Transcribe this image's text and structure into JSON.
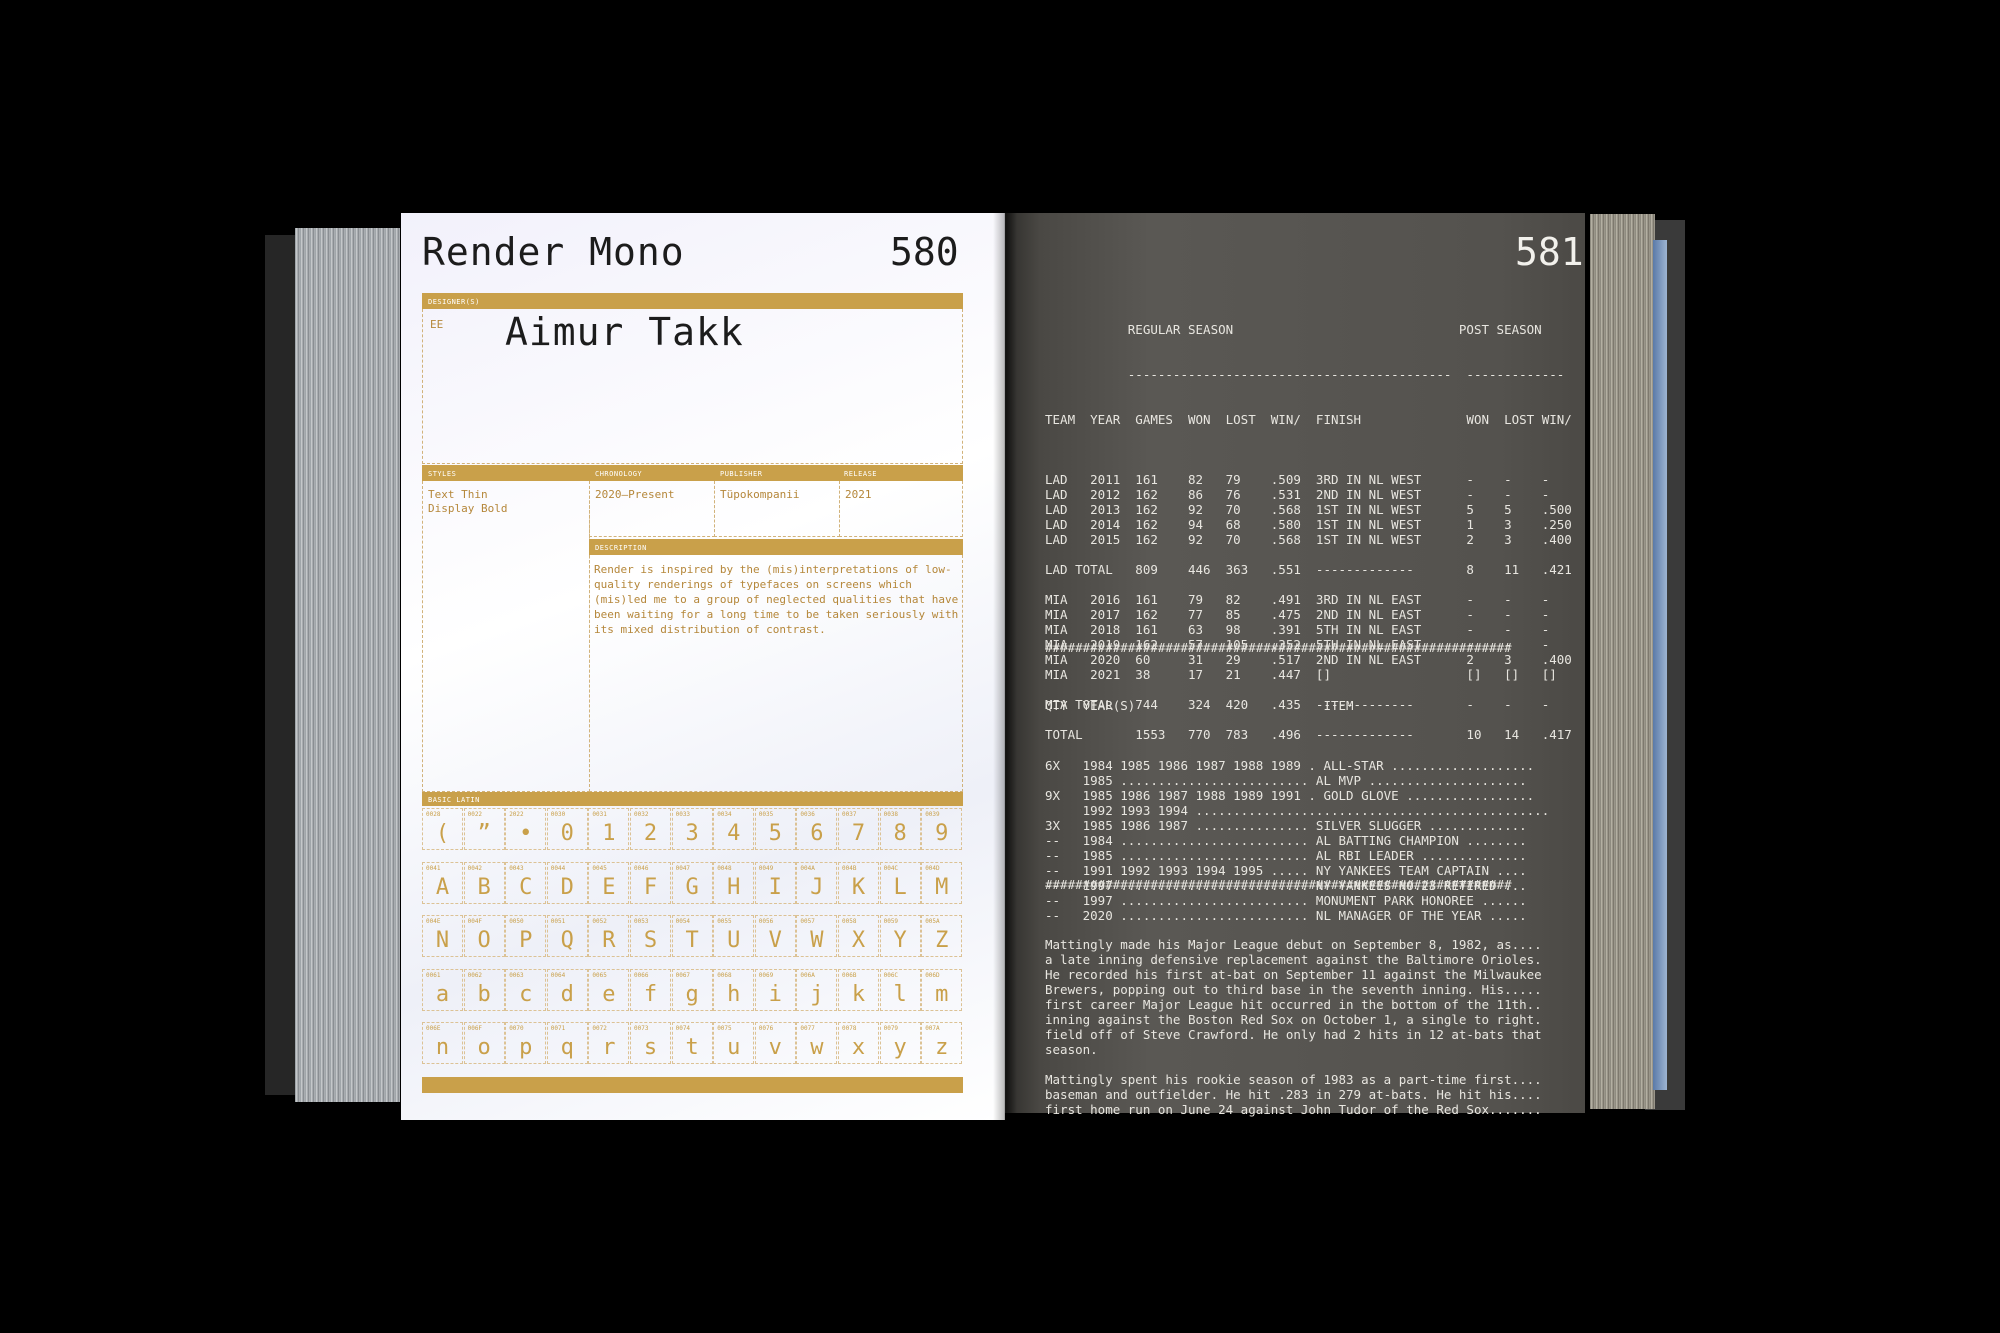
{
  "left_page": {
    "font_name": "Render Mono",
    "page_number": "580",
    "designer_label": "DESIGNER(S)",
    "designer_code": "EE",
    "designer_name": "Aimur Takk",
    "styles_label": "STYLES",
    "styles": [
      "Text Thin",
      "Display Bold"
    ],
    "chronology_label": "CHRONOLOGY",
    "chronology": "2020–Present",
    "publisher_label": "PUBLISHER",
    "publisher": "Tüpokompanii",
    "release_label": "RELEASE",
    "release": "2021",
    "description_label": "DESCRIPTION",
    "description": "Render is inspired by the (mis)interpretations of low-quality renderings of typefaces on screens which (mis)led me to a group of neglected qualities that have been waiting for a long time to be taken seriously with its mixed distribution of contrast.",
    "basic_latin_label": "BASIC LATIN",
    "glyph_rows": [
      [
        [
          "0028",
          "("
        ],
        [
          "0022",
          "”"
        ],
        [
          "2022",
          "•"
        ],
        [
          "0030",
          "0"
        ],
        [
          "0031",
          "1"
        ],
        [
          "0032",
          "2"
        ],
        [
          "0033",
          "3"
        ],
        [
          "0034",
          "4"
        ],
        [
          "0035",
          "5"
        ],
        [
          "0036",
          "6"
        ],
        [
          "0037",
          "7"
        ],
        [
          "0038",
          "8"
        ],
        [
          "0039",
          "9"
        ]
      ],
      [
        [
          "0041",
          "A"
        ],
        [
          "0042",
          "B"
        ],
        [
          "0043",
          "C"
        ],
        [
          "0044",
          "D"
        ],
        [
          "0045",
          "E"
        ],
        [
          "0046",
          "F"
        ],
        [
          "0047",
          "G"
        ],
        [
          "0048",
          "H"
        ],
        [
          "0049",
          "I"
        ],
        [
          "004A",
          "J"
        ],
        [
          "004B",
          "K"
        ],
        [
          "004C",
          "L"
        ],
        [
          "004D",
          "M"
        ]
      ],
      [
        [
          "004E",
          "N"
        ],
        [
          "004F",
          "O"
        ],
        [
          "0050",
          "P"
        ],
        [
          "0051",
          "Q"
        ],
        [
          "0052",
          "R"
        ],
        [
          "0053",
          "S"
        ],
        [
          "0054",
          "T"
        ],
        [
          "0055",
          "U"
        ],
        [
          "0056",
          "V"
        ],
        [
          "0057",
          "W"
        ],
        [
          "0058",
          "X"
        ],
        [
          "0059",
          "Y"
        ],
        [
          "005A",
          "Z"
        ]
      ],
      [
        [
          "0061",
          "a"
        ],
        [
          "0062",
          "b"
        ],
        [
          "0063",
          "c"
        ],
        [
          "0064",
          "d"
        ],
        [
          "0065",
          "e"
        ],
        [
          "0066",
          "f"
        ],
        [
          "0067",
          "g"
        ],
        [
          "0068",
          "h"
        ],
        [
          "0069",
          "i"
        ],
        [
          "006A",
          "j"
        ],
        [
          "006B",
          "k"
        ],
        [
          "006C",
          "l"
        ],
        [
          "006D",
          "m"
        ]
      ],
      [
        [
          "006E",
          "n"
        ],
        [
          "006F",
          "o"
        ],
        [
          "0070",
          "p"
        ],
        [
          "0071",
          "q"
        ],
        [
          "0072",
          "r"
        ],
        [
          "0073",
          "s"
        ],
        [
          "0074",
          "t"
        ],
        [
          "0075",
          "u"
        ],
        [
          "0076",
          "v"
        ],
        [
          "0077",
          "w"
        ],
        [
          "0078",
          "x"
        ],
        [
          "0079",
          "y"
        ],
        [
          "007A",
          "z"
        ]
      ]
    ]
  },
  "right_page": {
    "page_number": "581",
    "stats_header": [
      "           REGULAR SEASON                              POST SEASON",
      "           -------------------------------------------  -------------",
      "TEAM  YEAR  GAMES  WON  LOST  WIN/  FINISH              WON  LOST WIN/"
    ],
    "stats_lines": [
      "",
      "LAD   2011  161    82   79    .509  3RD IN NL WEST      -    -    -",
      "LAD   2012  162    86   76    .531  2ND IN NL WEST      -    -    -",
      "LAD   2013  162    92   70    .568  1ST IN NL WEST      5    5    .500",
      "LAD   2014  162    94   68    .580  1ST IN NL WEST      1    3    .250",
      "LAD   2015  162    92   70    .568  1ST IN NL WEST      2    3    .400",
      "",
      "LAD TOTAL   809    446  363   .551  -------------       8    11   .421",
      "",
      "MIA   2016  161    79   82    .491  3RD IN NL EAST      -    -    -",
      "MIA   2017  162    77   85    .475  2ND IN NL EAST      -    -    -",
      "MIA   2018  161    63   98    .391  5TH IN NL EAST      -    -    -",
      "MIA   2019  162    57   105   .352  5TH IN NL EAST      -    -    -",
      "MIA   2020  60     31   29    .517  2ND IN NL EAST      2    3    .400",
      "MIA   2021  38     17   21    .447  []                  []   []   []",
      "",
      "MIA TOTAL   744    324  420   .435  -------------       -    -    -",
      "",
      "TOTAL       1553   770  783   .496  -------------       10   14   .417"
    ],
    "divider": "##############################################################",
    "awards_header": "QTY  YEAR(S)                         ITEM",
    "award_lines": [
      "",
      "6X   1984 1985 1986 1987 1988 1989 . ALL-STAR ...................",
      "     1985 ......................... AL MVP .....................",
      "9X   1985 1986 1987 1988 1989 1991 . GOLD GLOVE .................",
      "     1992 1993 1994 ...............................................",
      "3X   1985 1986 1987 ............... SILVER SLUGGER .............",
      "--   1984 ......................... AL BATTING CHAMPION ........",
      "--   1985 ......................... AL RBI LEADER ..............",
      "--   1991 1992 1993 1994 1995 ..... NY YANKEES TEAM CAPTAIN ....",
      "--   1997 ......................... NY YANKEES NO.23 RETIRED ...",
      "--   1997 ......................... MONUMENT PARK HONOREE ......",
      "--   2020 ......................... NL MANAGER OF THE YEAR .....",
      ""
    ],
    "bio_lines": [
      "Mattingly made his Major League debut on September 8, 1982, as....",
      "a late inning defensive replacement against the Baltimore Orioles.",
      "He recorded his first at-bat on September 11 against the Milwaukee",
      "Brewers, popping out to third base in the seventh inning. His.....",
      "first career Major League hit occurred in the bottom of the 11th..",
      "inning against the Boston Red Sox on October 1, a single to right.",
      "field off of Steve Crawford. He only had 2 hits in 12 at-bats that",
      "season.",
      "",
      "Mattingly spent his rookie season of 1983 as a part-time first....",
      "baseman and outfielder. He hit .283 in 279 at-bats. He hit his....",
      "first home run on June 24 against John Tudor of the Red Sox......."
    ]
  }
}
